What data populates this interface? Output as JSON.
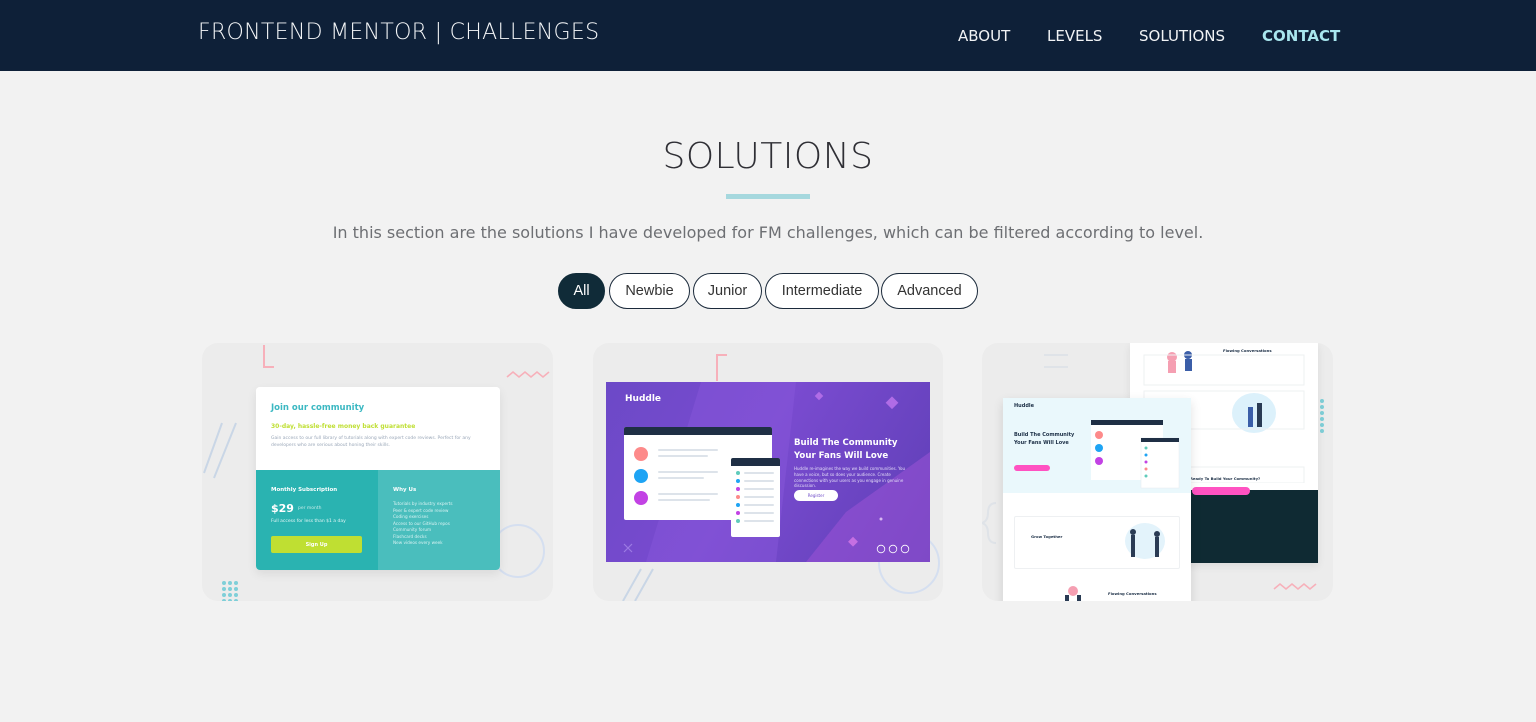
{
  "header": {
    "brand": "FRONTEND MENTOR | CHALLENGES",
    "nav": [
      "ABOUT",
      "LEVELS",
      "SOLUTIONS",
      "CONTACT"
    ],
    "active_nav": "CONTACT",
    "bg_color": "#0e2038",
    "accent_color": "#a9e7ef"
  },
  "section": {
    "title": "SOLUTIONS",
    "subtitle": "In this section are the solutions I have developed for FM challenges, which can be filtered according to level.",
    "filters": [
      "All",
      "Newbie",
      "Junior",
      "Intermediate",
      "Advanced"
    ],
    "active_filter": "All"
  },
  "cards": [
    {
      "heading": "Join our community",
      "guarantee": "30-day, hassle-free money back guarantee",
      "description": "Gain access to our full library of tutorials along with expert code reviews. Perfect for any developers who are serious about honing their skills.",
      "plan_title": "Monthly Subscription",
      "price": "$29",
      "per": "per month",
      "full_access": "Full access for less than $1 a day",
      "cta": "Sign Up",
      "why_title": "Why Us",
      "why_items": [
        "Tutorials by industry experts",
        "Peer & expert code review",
        "Coding exercises",
        "Access to our GitHub repos",
        "Community forum",
        "Flashcard decks",
        "New videos every week"
      ]
    },
    {
      "logo": "Huddle",
      "heading_line1": "Build The Community",
      "heading_line2": "Your Fans Will Love",
      "description": "Huddle re-imagines the way we build communities. You have a voice, but so does your audience. Create connections with your users as you engage in genuine discussion.",
      "cta": "Register"
    },
    {
      "logo": "Huddle",
      "heading_line1": "Build The Community",
      "heading_line2": "Your Fans Will Love",
      "sec_grow": "Grow Together",
      "sec_flowing": "Flowing Conversations",
      "sec_ready": "Ready To Build Your Community?"
    }
  ]
}
